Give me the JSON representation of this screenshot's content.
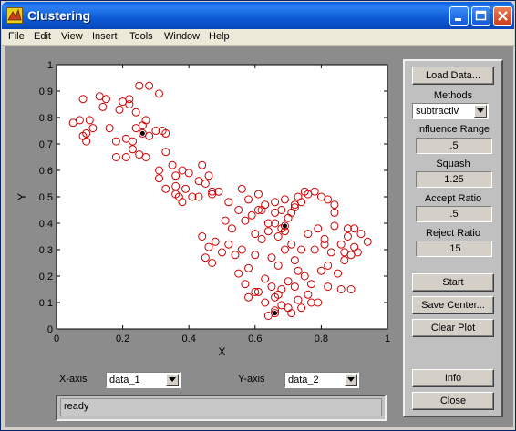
{
  "window": {
    "title": "Clustering",
    "icon": "matlab-icon"
  },
  "menubar": {
    "items": [
      "File",
      "Edit",
      "View",
      "Insert",
      "Tools",
      "Window",
      "Help"
    ]
  },
  "controls": {
    "load_data": "Load Data...",
    "methods_label": "Methods",
    "method_value": "subtractiv",
    "influence_label": "Influence Range",
    "influence_value": ".5",
    "squash_label": "Squash",
    "squash_value": "1.25",
    "accept_label": "Accept Ratio",
    "accept_value": ".5",
    "reject_label": "Reject Ratio",
    "reject_value": ".15",
    "start": "Start",
    "save_center": "Save Center...",
    "clear_plot": "Clear Plot",
    "info": "Info",
    "close": "Close"
  },
  "axis_selectors": {
    "x_label": "X-axis",
    "x_value": "data_1",
    "y_label": "Y-axis",
    "y_value": "data_2"
  },
  "status": {
    "text": "ready"
  },
  "colors": {
    "points": "#cc0000",
    "centers": "#000000",
    "panel_bg": "#8c8c8c"
  },
  "chart_data": {
    "type": "scatter",
    "xlabel": "X",
    "ylabel": "Y",
    "xlim": [
      0,
      1
    ],
    "ylim": [
      0,
      1
    ],
    "xticks": [
      "0",
      "0.2",
      "0.4",
      "0.6",
      "0.8",
      "1"
    ],
    "yticks": [
      "0",
      "0.1",
      "0.2",
      "0.3",
      "0.4",
      "0.5",
      "0.6",
      "0.7",
      "0.8",
      "0.9",
      "1"
    ],
    "grid": false,
    "series": [
      {
        "marker": "open-circle",
        "x": [
          0.25,
          0.28,
          0.22,
          0.31,
          0.13,
          0.15,
          0.14,
          0.08,
          0.1,
          0.11,
          0.07,
          0.05,
          0.08,
          0.09,
          0.09,
          0.16,
          0.18,
          0.21,
          0.23,
          0.25,
          0.27,
          0.28,
          0.3,
          0.32,
          0.33,
          0.24,
          0.27,
          0.19,
          0.2,
          0.22,
          0.24,
          0.26,
          0.21,
          0.23,
          0.18,
          0.31,
          0.33,
          0.35,
          0.36,
          0.38,
          0.4,
          0.36,
          0.37,
          0.39,
          0.41,
          0.43,
          0.44,
          0.45,
          0.46,
          0.47,
          0.31,
          0.33,
          0.36,
          0.38,
          0.43,
          0.47,
          0.49,
          0.52,
          0.55,
          0.44,
          0.46,
          0.48,
          0.51,
          0.53,
          0.45,
          0.47,
          0.5,
          0.52,
          0.54,
          0.56,
          0.58,
          0.6,
          0.62,
          0.64,
          0.66,
          0.68,
          0.7,
          0.71,
          0.72,
          0.73,
          0.75,
          0.56,
          0.58,
          0.61,
          0.63,
          0.66,
          0.69,
          0.72,
          0.74,
          0.76,
          0.78,
          0.8,
          0.82,
          0.84,
          0.57,
          0.59,
          0.61,
          0.64,
          0.67,
          0.69,
          0.71,
          0.74,
          0.76,
          0.79,
          0.81,
          0.83,
          0.86,
          0.88,
          0.9,
          0.92,
          0.94,
          0.55,
          0.57,
          0.6,
          0.63,
          0.65,
          0.67,
          0.7,
          0.72,
          0.75,
          0.77,
          0.8,
          0.82,
          0.85,
          0.87,
          0.89,
          0.91,
          0.58,
          0.61,
          0.63,
          0.66,
          0.68,
          0.7,
          0.73,
          0.76,
          0.79,
          0.82,
          0.86,
          0.89,
          0.64,
          0.66,
          0.68,
          0.71,
          0.74,
          0.77,
          0.65,
          0.67,
          0.69,
          0.72,
          0.73,
          0.62,
          0.78,
          0.81,
          0.84,
          0.87,
          0.9,
          0.6,
          0.84,
          0.88,
          0.68,
          0.66
        ],
        "y": [
          0.92,
          0.92,
          0.87,
          0.89,
          0.88,
          0.87,
          0.84,
          0.87,
          0.79,
          0.76,
          0.79,
          0.78,
          0.73,
          0.71,
          0.74,
          0.76,
          0.71,
          0.72,
          0.71,
          0.66,
          0.65,
          0.73,
          0.75,
          0.75,
          0.74,
          0.76,
          0.79,
          0.83,
          0.86,
          0.85,
          0.82,
          0.77,
          0.65,
          0.68,
          0.65,
          0.6,
          0.67,
          0.62,
          0.58,
          0.6,
          0.59,
          0.54,
          0.5,
          0.53,
          0.5,
          0.56,
          0.62,
          0.55,
          0.58,
          0.52,
          0.57,
          0.53,
          0.51,
          0.48,
          0.5,
          0.51,
          0.52,
          0.48,
          0.45,
          0.35,
          0.31,
          0.33,
          0.41,
          0.38,
          0.27,
          0.25,
          0.29,
          0.32,
          0.28,
          0.3,
          0.23,
          0.28,
          0.34,
          0.37,
          0.4,
          0.38,
          0.42,
          0.44,
          0.47,
          0.5,
          0.52,
          0.53,
          0.49,
          0.51,
          0.47,
          0.44,
          0.49,
          0.46,
          0.48,
          0.51,
          0.52,
          0.5,
          0.49,
          0.47,
          0.41,
          0.43,
          0.45,
          0.4,
          0.35,
          0.37,
          0.32,
          0.3,
          0.36,
          0.38,
          0.34,
          0.29,
          0.32,
          0.35,
          0.31,
          0.36,
          0.33,
          0.21,
          0.17,
          0.14,
          0.19,
          0.16,
          0.13,
          0.18,
          0.16,
          0.2,
          0.17,
          0.22,
          0.24,
          0.21,
          0.26,
          0.28,
          0.29,
          0.12,
          0.14,
          0.1,
          0.12,
          0.15,
          0.08,
          0.11,
          0.13,
          0.1,
          0.16,
          0.15,
          0.15,
          0.05,
          0.07,
          0.09,
          0.06,
          0.08,
          0.1,
          0.27,
          0.24,
          0.3,
          0.26,
          0.22,
          0.45,
          0.3,
          0.32,
          0.44,
          0.29,
          0.38,
          0.36,
          0.39,
          0.38,
          0.45,
          0.48
        ]
      },
      {
        "name": "centers",
        "marker": "filled-dot",
        "x": [
          0.26,
          0.69,
          0.66
        ],
        "y": [
          0.74,
          0.39,
          0.06
        ]
      }
    ]
  }
}
